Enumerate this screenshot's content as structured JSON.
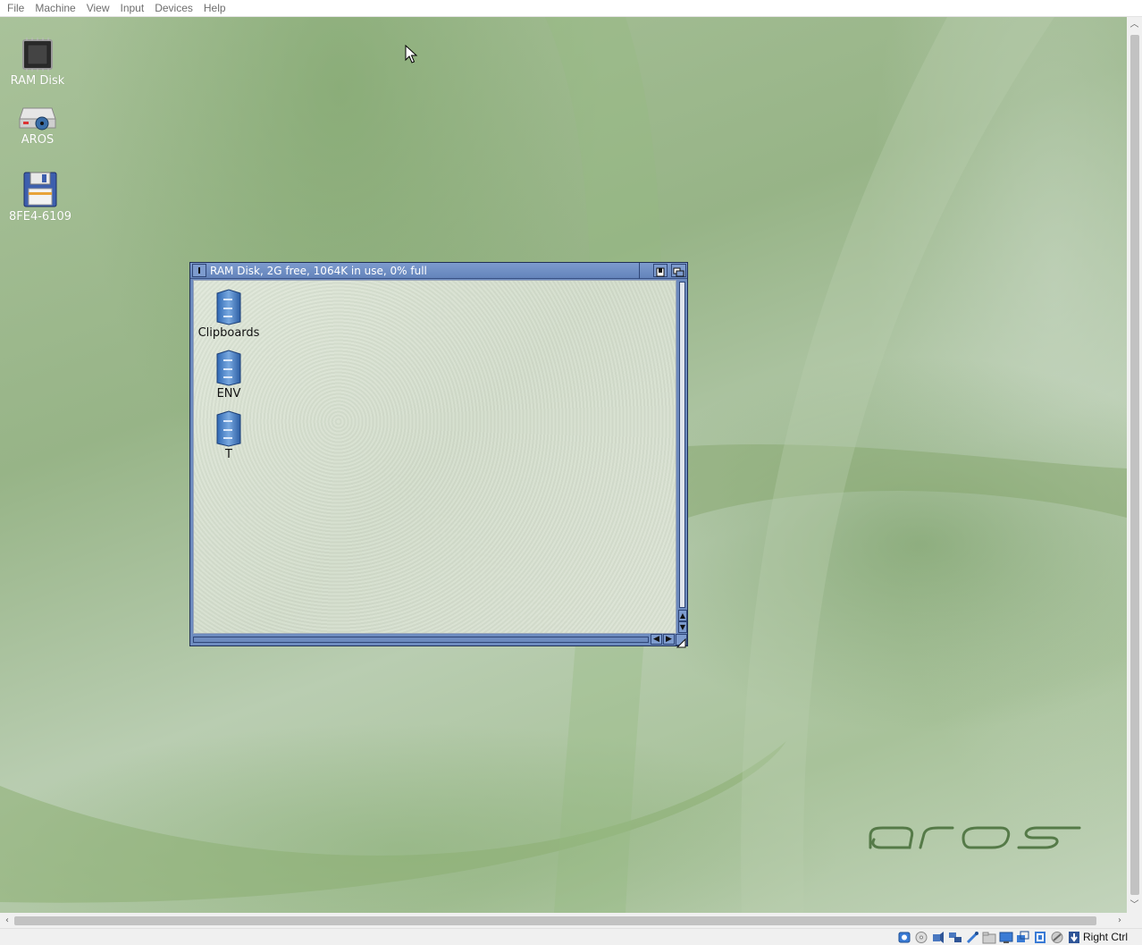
{
  "menubar": {
    "items": [
      "File",
      "Machine",
      "View",
      "Input",
      "Devices",
      "Help"
    ]
  },
  "desktop": {
    "icons": [
      {
        "label": "RAM Disk",
        "icon": "ram-chip-icon"
      },
      {
        "label": "AROS",
        "icon": "hard-drive-icon"
      },
      {
        "label": "8FE4-6109",
        "icon": "floppy-disk-icon"
      }
    ],
    "logo_text": "aros"
  },
  "window": {
    "title": "RAM Disk,  2G free, 1064K in use, 0% full",
    "drawers": [
      {
        "label": "Clipboards",
        "icon": "drawer-icon"
      },
      {
        "label": "ENV",
        "icon": "drawer-icon"
      },
      {
        "label": "T",
        "icon": "drawer-icon"
      }
    ]
  },
  "statusbar": {
    "host_key": "Right Ctrl"
  },
  "colors": {
    "window_frame": "#6d8bbf",
    "desktop_green": "#a9c29a"
  }
}
